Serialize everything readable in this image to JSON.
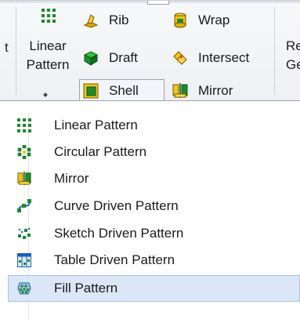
{
  "ribbon": {
    "left_cut_label": "t",
    "right_cut_label_1": "Re",
    "right_cut_label_2": "Ge",
    "linear_pattern": {
      "line1": "Linear",
      "line2": "Pattern",
      "icon": "linear-pattern-icon"
    },
    "features": [
      {
        "label": "Rib",
        "icon": "rib-icon"
      },
      {
        "label": "Wrap",
        "icon": "wrap-icon"
      },
      {
        "label": "Draft",
        "icon": "draft-icon"
      },
      {
        "label": "Intersect",
        "icon": "intersect-icon"
      },
      {
        "label": "Shell",
        "icon": "shell-icon"
      },
      {
        "label": "Mirror",
        "icon": "mirror-icon"
      }
    ]
  },
  "menu": {
    "items": [
      {
        "label": "Linear Pattern",
        "icon": "linear-pattern-icon"
      },
      {
        "label": "Circular Pattern",
        "icon": "circular-pattern-icon"
      },
      {
        "label": "Mirror",
        "icon": "mirror-icon"
      },
      {
        "label": "Curve Driven Pattern",
        "icon": "curve-driven-pattern-icon"
      },
      {
        "label": "Sketch Driven Pattern",
        "icon": "sketch-driven-pattern-icon"
      },
      {
        "label": "Table Driven Pattern",
        "icon": "table-driven-pattern-icon"
      },
      {
        "label": "Fill Pattern",
        "icon": "fill-pattern-icon"
      }
    ],
    "hovered_item": "Fill Pattern"
  },
  "colors": {
    "hover_bg": "#dbe7f7",
    "hover_border": "#a6c3ea",
    "accent_green": "#1e8a2e",
    "accent_yellow": "#f0c419"
  }
}
